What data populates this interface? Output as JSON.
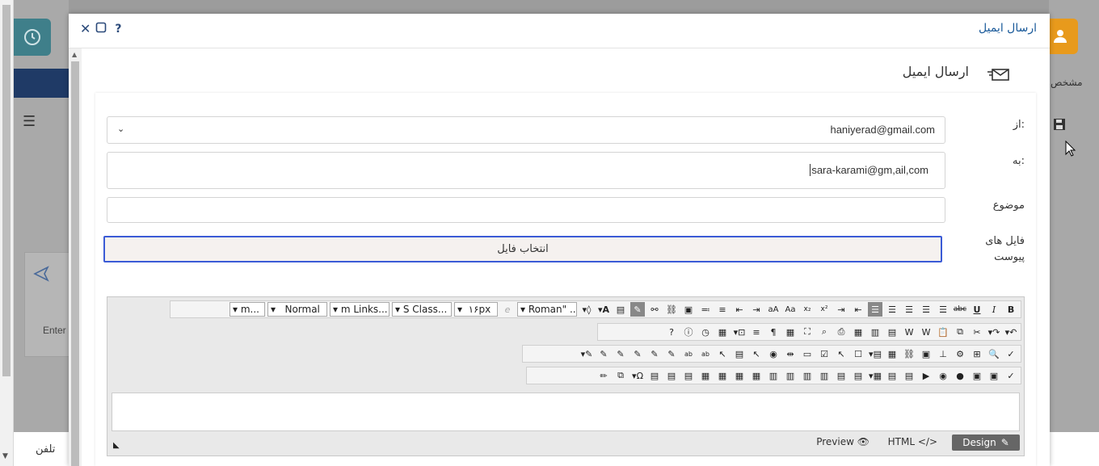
{
  "background": {
    "phone_label": "تلفن",
    "enter_label": "Enter",
    "right_label": "مشخص"
  },
  "modal": {
    "title": "ارسال ایمیل",
    "help_label": "?"
  },
  "section": {
    "heading": "ارسال ایمیل"
  },
  "form": {
    "from_label": "از:",
    "from_value": "haniyerad@gmail.com",
    "to_label": "به:",
    "to_value": "sara-karami@gm,ail,com",
    "subject_label": "موضوع",
    "subject_value": "",
    "attachments_label_line1": "فایل های",
    "attachments_label_line2": "پیوست",
    "choose_file_label": "انتخاب فایل"
  },
  "editor": {
    "font_name": "Roman\" ..",
    "font_size": "۱۶px",
    "css_class": "S Class...",
    "links": "m Links...",
    "paragraph": "Normal",
    "snippets": "m...",
    "tab_design": "Design",
    "tab_html": "HTML",
    "tab_preview": "Preview"
  },
  "colors": {
    "accent_blue": "#1a5a9a",
    "file_border": "#3b5bd6",
    "user_icon_bg": "#e89a1c",
    "clock_bg": "#3f7f8a"
  }
}
